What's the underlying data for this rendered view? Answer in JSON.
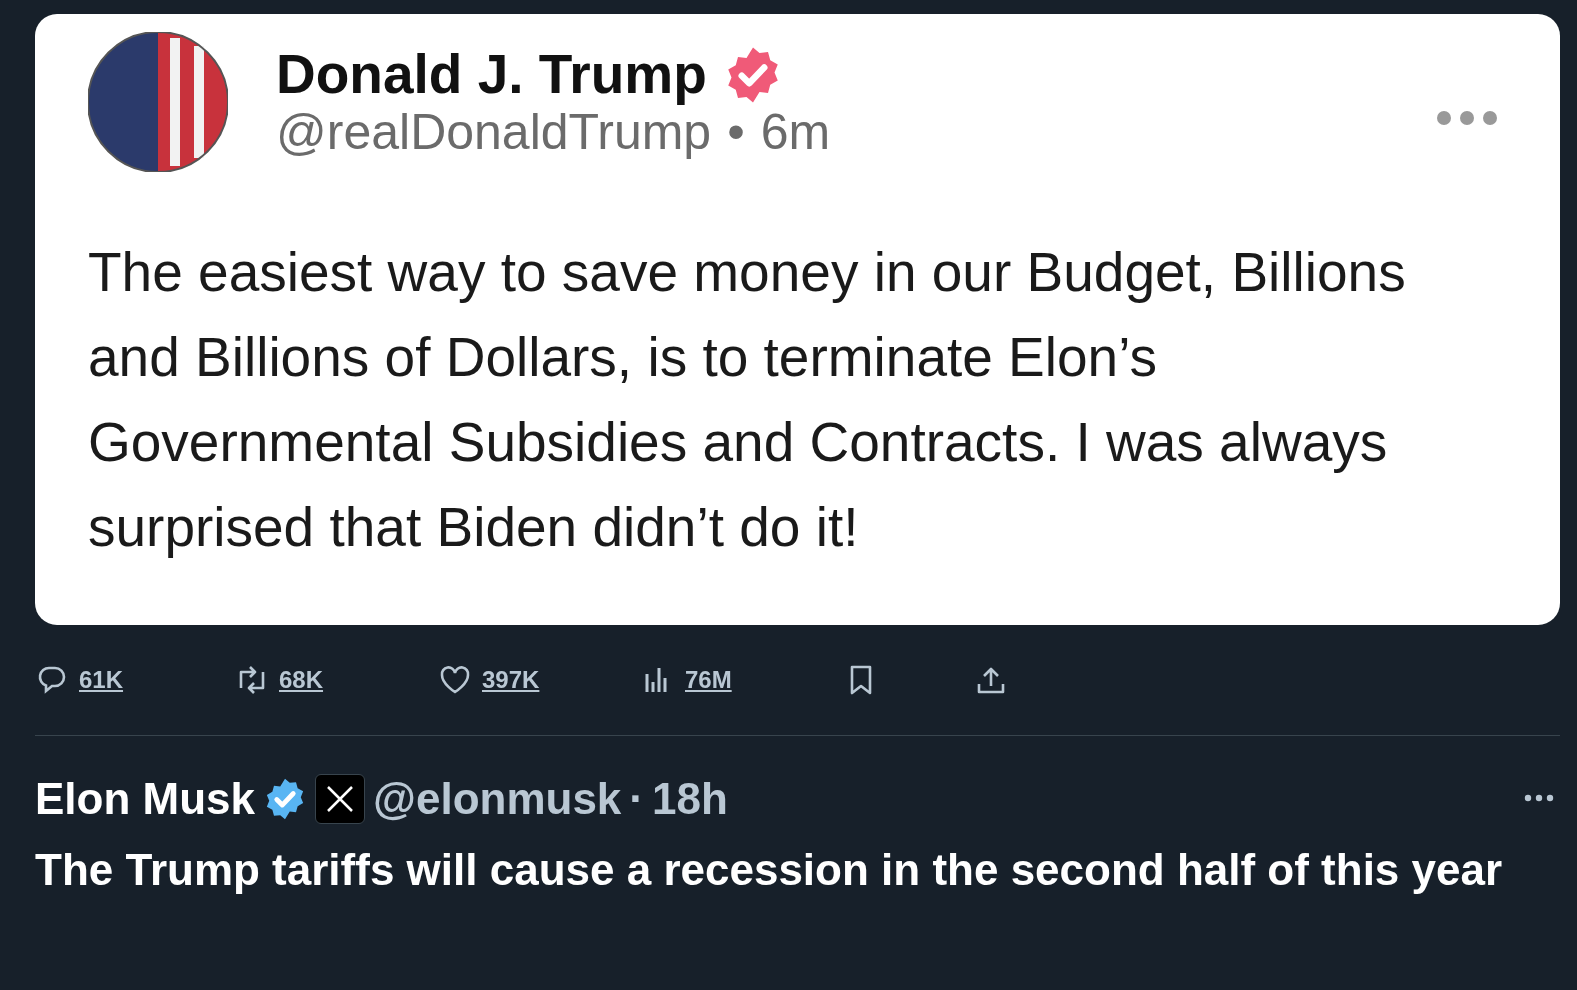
{
  "post": {
    "author": {
      "name": "Donald J. Trump",
      "verified": true,
      "handle": "@realDonaldTrump",
      "separator": "•",
      "time": "6m"
    },
    "text": "The easiest way to save money in our Budget, Billions and Billions of Dollars, is to terminate Elon’s Governmental Subsidies and Contracts. I was always surprised that Biden didn’t do it!",
    "actions": [
      {
        "kind": "reply",
        "count": "61K"
      },
      {
        "kind": "repost",
        "count": "68K"
      },
      {
        "kind": "like",
        "count": "397K"
      },
      {
        "kind": "views",
        "count": "76M"
      },
      {
        "kind": "bookmark"
      },
      {
        "kind": "share"
      }
    ]
  },
  "reply": {
    "name": "Elon Musk",
    "verified": true,
    "handle": "@elonmusk",
    "separator": "·",
    "time": "18h",
    "text": "The Trump tariffs will cause a recession in the second half of this year"
  }
}
